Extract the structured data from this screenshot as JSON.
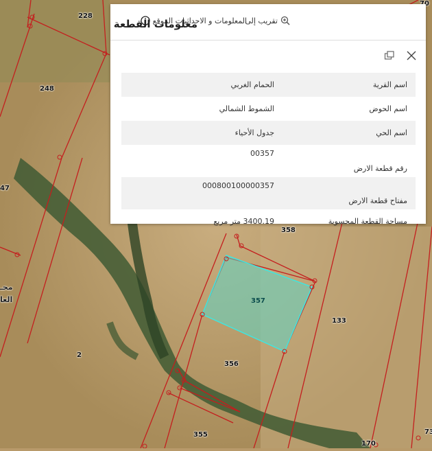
{
  "map": {
    "parcel_labels": [
      "228",
      "248",
      "47",
      "2",
      "358",
      "357",
      "133",
      "356",
      "355",
      "170",
      "73",
      "70"
    ],
    "edge_text": "محـ",
    "edge_text2": "العا",
    "selected_parcel_color": "#5fd6c4",
    "line_color": "#c41e1e"
  },
  "popup": {
    "actions": {
      "zoom_label": "تقريب إلى",
      "info_label": "المعلومات و الاحداثيات الموقع"
    },
    "title": "معلومات القطعة",
    "rows": [
      {
        "key": "اسم القرية",
        "value": "الحمام الغربي"
      },
      {
        "key": "اسم الحوض",
        "value": "الشموط الشمالي"
      },
      {
        "key": "اسم الحي",
        "value": "جدول الأحياء"
      },
      {
        "key": "رقم قطعة الارض",
        "value": "00357"
      },
      {
        "key": "مفتاح قطعة الارض",
        "value": "000800100000357"
      },
      {
        "key": "مساحة القطعة المحسوبة",
        "value": "3400.19 متر مربع"
      }
    ]
  }
}
